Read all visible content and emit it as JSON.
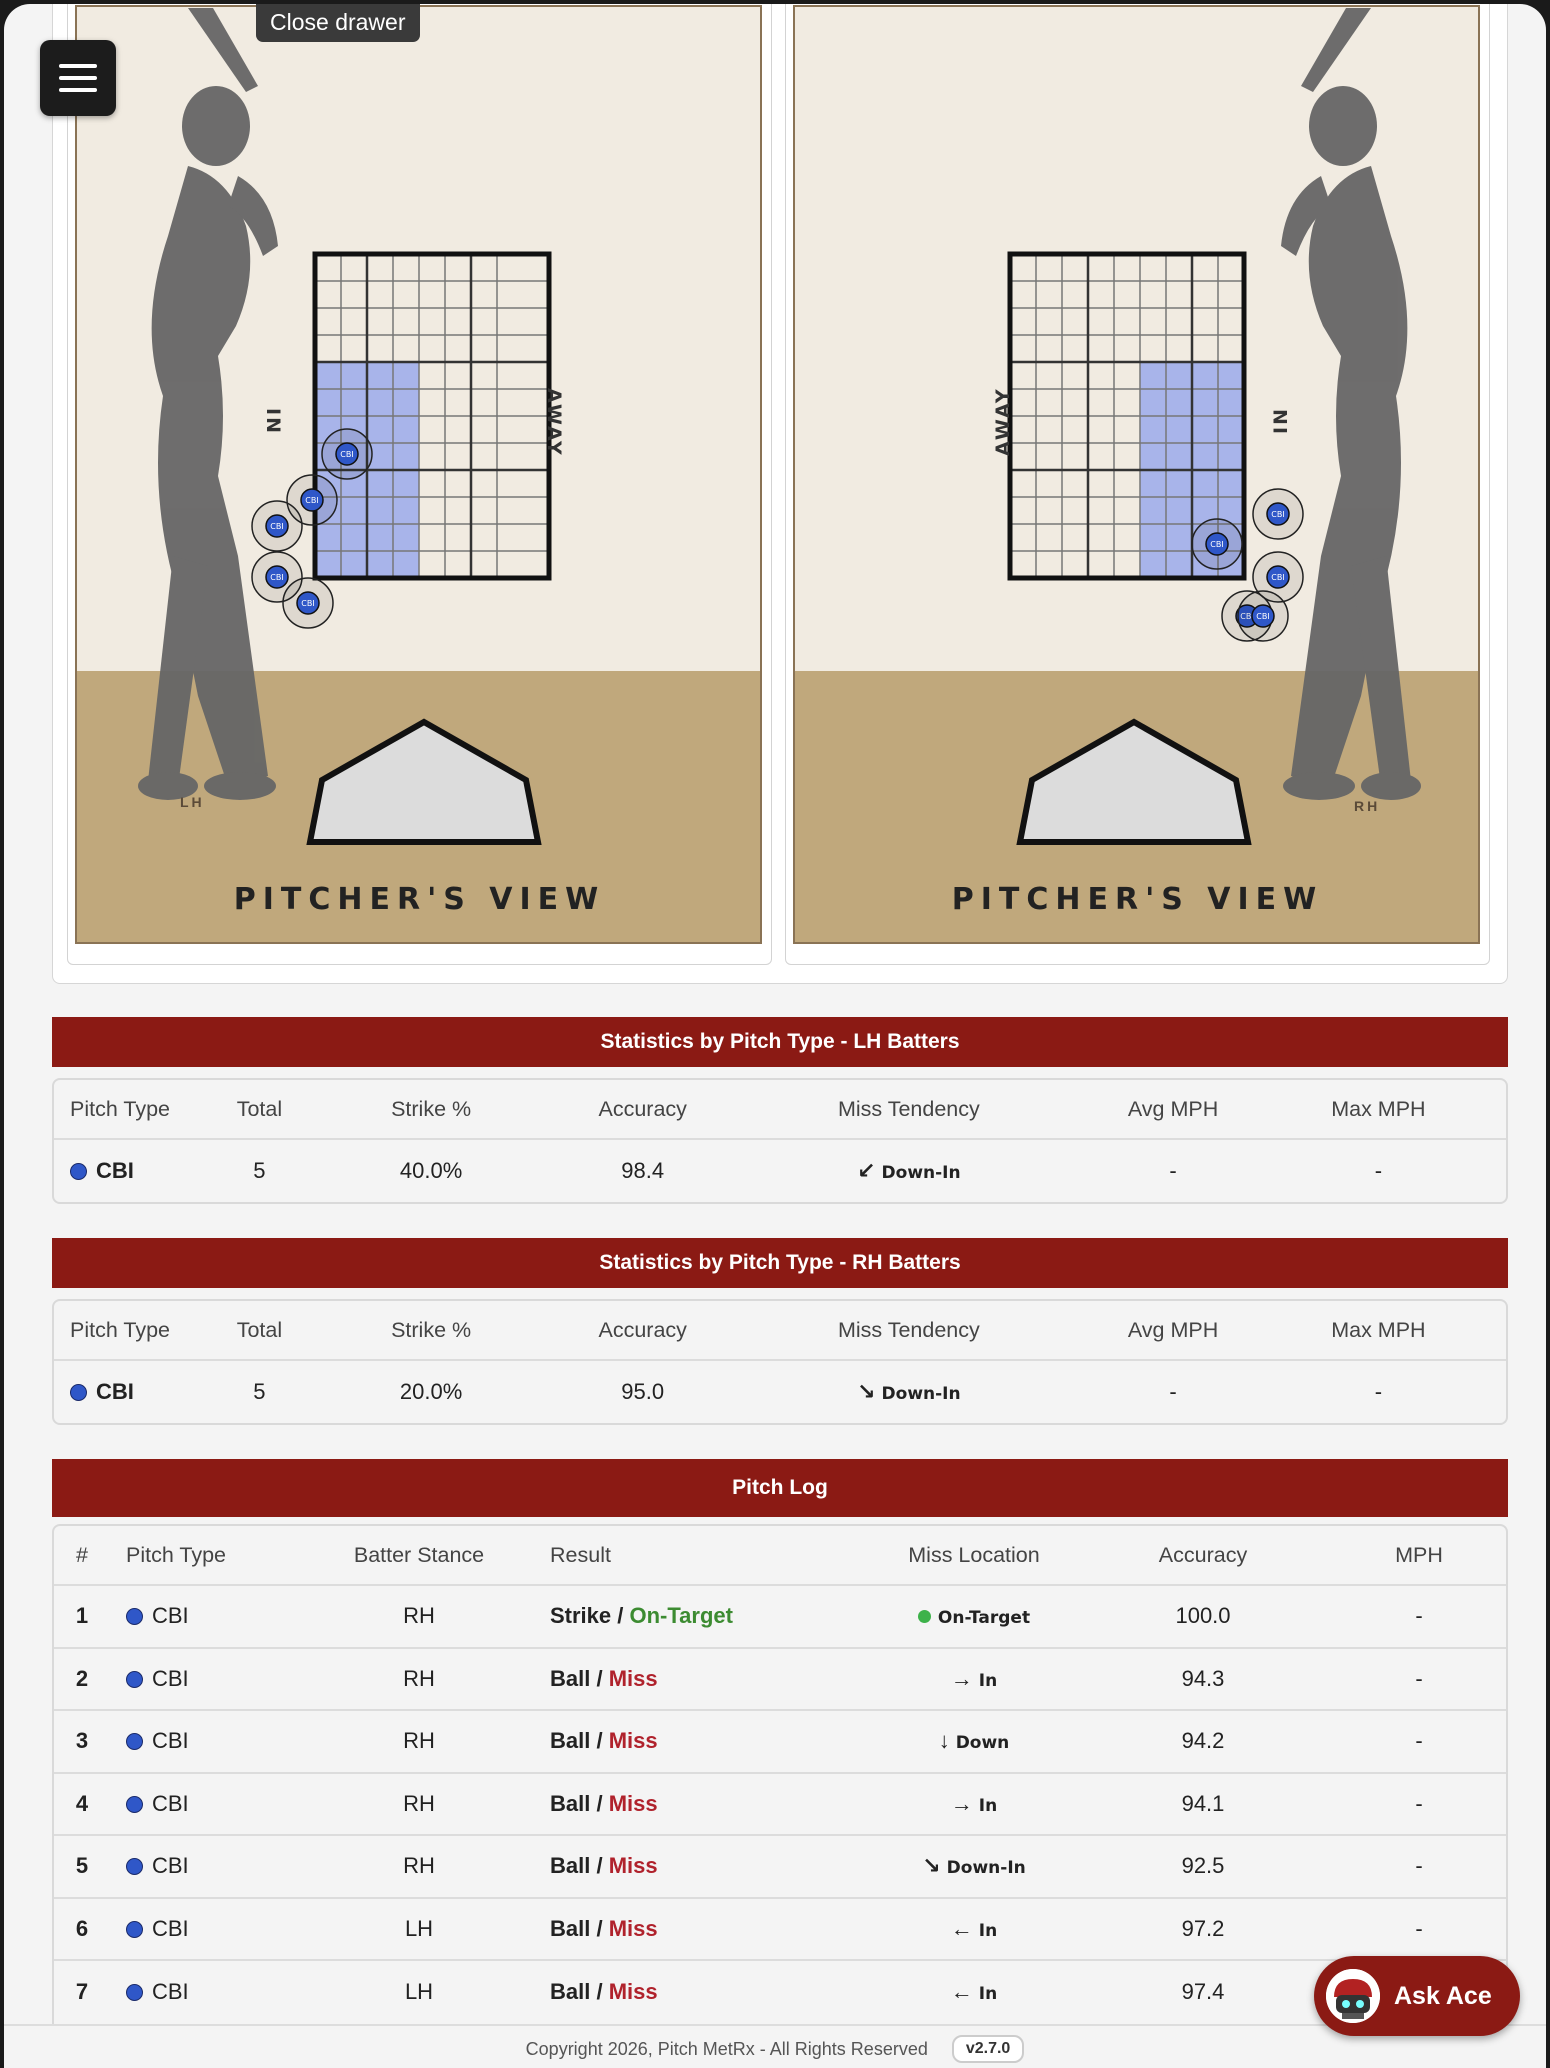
{
  "tooltip": "Close drawer",
  "zones": {
    "left": {
      "view_label": "PITCHER'S VIEW",
      "stance": "LH",
      "in_label": "IN",
      "away_label": "AWAY"
    },
    "right": {
      "view_label": "PITCHER'S VIEW",
      "stance": "RH",
      "in_label": "IN",
      "away_label": "AWAY"
    },
    "pitch_marker_label": "CBI"
  },
  "stats_lh": {
    "title": "Statistics by Pitch Type - LH Batters",
    "headers": [
      "Pitch Type",
      "Total",
      "Strike %",
      "Accuracy",
      "Miss Tendency",
      "Avg MPH",
      "Max MPH"
    ],
    "row": {
      "pitch": "CBI",
      "total": "5",
      "strike": "40.0%",
      "accuracy": "98.4",
      "tendency_arrow": "↙",
      "tendency": "Down-In",
      "avg_mph": "-",
      "max_mph": "-"
    }
  },
  "stats_rh": {
    "title": "Statistics by Pitch Type - RH Batters",
    "headers": [
      "Pitch Type",
      "Total",
      "Strike %",
      "Accuracy",
      "Miss Tendency",
      "Avg MPH",
      "Max MPH"
    ],
    "row": {
      "pitch": "CBI",
      "total": "5",
      "strike": "20.0%",
      "accuracy": "95.0",
      "tendency_arrow": "↘",
      "tendency": "Down-In",
      "avg_mph": "-",
      "max_mph": "-"
    }
  },
  "pitch_log": {
    "title": "Pitch Log",
    "headers": [
      "#",
      "Pitch Type",
      "Batter Stance",
      "Result",
      "Miss Location",
      "Accuracy",
      "MPH"
    ],
    "rows": [
      {
        "n": "1",
        "pitch": "CBI",
        "stance": "RH",
        "result": "Strike",
        "outcome": "On-Target",
        "arrow": "●",
        "loc": "On-Target",
        "acc": "100.0",
        "mph": "-"
      },
      {
        "n": "2",
        "pitch": "CBI",
        "stance": "RH",
        "result": "Ball",
        "outcome": "Miss",
        "arrow": "→",
        "loc": "In",
        "acc": "94.3",
        "mph": "-"
      },
      {
        "n": "3",
        "pitch": "CBI",
        "stance": "RH",
        "result": "Ball",
        "outcome": "Miss",
        "arrow": "↓",
        "loc": "Down",
        "acc": "94.2",
        "mph": "-"
      },
      {
        "n": "4",
        "pitch": "CBI",
        "stance": "RH",
        "result": "Ball",
        "outcome": "Miss",
        "arrow": "→",
        "loc": "In",
        "acc": "94.1",
        "mph": "-"
      },
      {
        "n": "5",
        "pitch": "CBI",
        "stance": "RH",
        "result": "Ball",
        "outcome": "Miss",
        "arrow": "↘",
        "loc": "Down-In",
        "acc": "92.5",
        "mph": "-"
      },
      {
        "n": "6",
        "pitch": "CBI",
        "stance": "LH",
        "result": "Ball",
        "outcome": "Miss",
        "arrow": "←",
        "loc": "In",
        "acc": "97.2",
        "mph": "-"
      },
      {
        "n": "7",
        "pitch": "CBI",
        "stance": "LH",
        "result": "Ball",
        "outcome": "Miss",
        "arrow": "←",
        "loc": "In",
        "acc": "97.4",
        "mph": "-"
      }
    ]
  },
  "footer": {
    "copyright": "Copyright 2026, Pitch MetRx - All Rights Reserved",
    "version": "v2.7.0"
  },
  "ask_ace": {
    "label": "Ask Ace"
  },
  "colors": {
    "accent": "#8b1a14",
    "pitch_dot": "#2f57c8",
    "strike_zone_fill": "#a8b4ea",
    "dirt": "#c0a87c",
    "wall": "#f1ebe1"
  },
  "icons": {
    "menu": "hamburger-icon",
    "ace": "robot-avatar-icon"
  }
}
